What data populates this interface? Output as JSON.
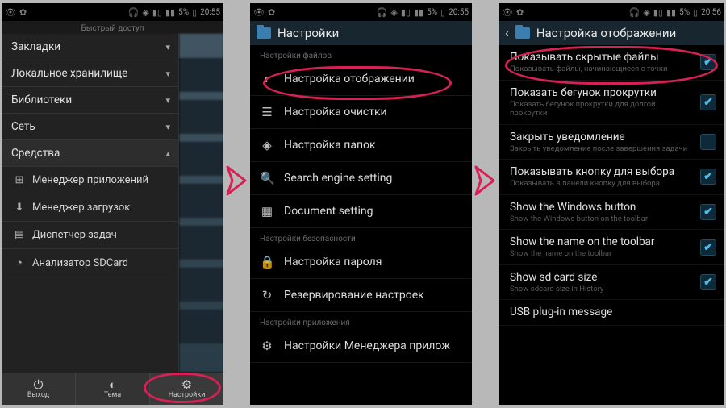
{
  "statusbar": {
    "battery": "5%",
    "time1": "20:55",
    "time2": "20:55",
    "time3": "20:56",
    "icons_left": [
      "👁",
      "✿"
    ],
    "icons_right": [
      "🎧",
      "◈",
      "📶",
      "📶"
    ]
  },
  "screen1": {
    "header": "Быстрый доступ",
    "categories": [
      {
        "label": "Закладки"
      },
      {
        "label": "Локальное хранилище"
      },
      {
        "label": "Библиотеки"
      },
      {
        "label": "Сеть"
      },
      {
        "label": "Средства"
      }
    ],
    "tools": [
      {
        "icon": "⊞",
        "label": "Менеджер приложений"
      },
      {
        "icon": "⬇",
        "label": "Менеджер загрузок"
      },
      {
        "icon": "▤",
        "label": "Диспетчер задач"
      },
      {
        "icon": "◔",
        "label": "Анализатор SDCard"
      }
    ],
    "bottombar": [
      {
        "icon": "⏻",
        "label": "Выход"
      },
      {
        "icon": "◐",
        "label": "Тема"
      },
      {
        "icon": "⚙",
        "label": "Настройки"
      }
    ]
  },
  "screen2": {
    "title": "Настройки",
    "section1_label": "Настройки файлов",
    "items1": [
      {
        "icon": "◐",
        "label": "Настройка отображении"
      },
      {
        "icon": "☰",
        "label": "Настройка очистки"
      },
      {
        "icon": "◈",
        "label": "Настройка папок"
      },
      {
        "icon": "🔍",
        "label": "Search engine setting"
      },
      {
        "icon": "▦",
        "label": "Document setting"
      }
    ],
    "section2_label": "Настройки безопасности",
    "items2": [
      {
        "icon": "🔒",
        "label": "Настройка пароля"
      },
      {
        "icon": "↻",
        "label": "Резервирование настроек"
      }
    ],
    "section3_label": "Настройки приложения",
    "items3": [
      {
        "icon": "⚙",
        "label": "Настройки Менеджера прилож"
      }
    ]
  },
  "screen3": {
    "title": "Настройка отображении",
    "items": [
      {
        "title": "Показывать скрытые файлы",
        "desc": "Показывать файлы, начинающиеся с точки",
        "checked": true
      },
      {
        "title": "Показать бегунок прокрутки",
        "desc": "Показать бегунок прокрутки для долгой прокрутки",
        "checked": true
      },
      {
        "title": "Закрыть уведомление",
        "desc": "Закрыть уведомление после завершения задачи",
        "checked": false
      },
      {
        "title": "Показывать кнопку для выбора",
        "desc": "Показывать в панели кнопку для выбора",
        "checked": true
      },
      {
        "title": "Show the Windows button",
        "desc": "Show the Windows button on the toolbar",
        "checked": true
      },
      {
        "title": "Show the name on the toolbar",
        "desc": "Show the name on the toolbar",
        "checked": true
      },
      {
        "title": "Show sd card size",
        "desc": "Show sdcard size in History",
        "checked": true
      },
      {
        "title": "USB plug-in message",
        "desc": ""
      }
    ]
  }
}
